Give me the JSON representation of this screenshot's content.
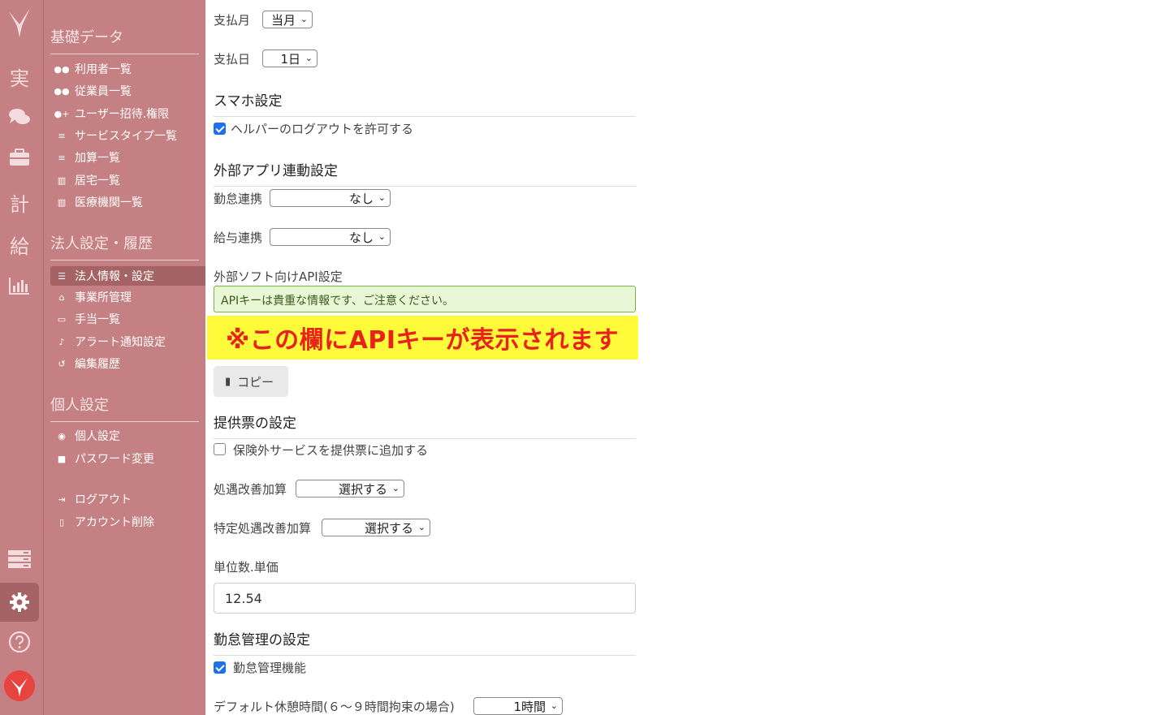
{
  "rail": {
    "items": [
      {
        "name": "logo",
        "glyph": "",
        "icon": "app-logo-icon"
      },
      {
        "name": "jisseki",
        "glyph": "実"
      },
      {
        "name": "chat",
        "glyph": "",
        "icon": "chat-bubbles-icon"
      },
      {
        "name": "briefcase",
        "glyph": "",
        "icon": "briefcase-icon"
      },
      {
        "name": "keikaku",
        "glyph": "計"
      },
      {
        "name": "kyuyo",
        "glyph": "給"
      },
      {
        "name": "chart",
        "glyph": "",
        "icon": "bar-chart-icon"
      },
      {
        "name": "server",
        "glyph": "",
        "icon": "server-icon"
      },
      {
        "name": "settings",
        "glyph": "",
        "icon": "gear-icon"
      },
      {
        "name": "help",
        "glyph": "",
        "icon": "help-circle-icon"
      },
      {
        "name": "brand",
        "glyph": "",
        "icon": "brand-logo-icon"
      }
    ]
  },
  "sidebar": {
    "section1_title": "基礎データ",
    "section1_items": [
      "利用者一覧",
      "従業員一覧",
      "ユーザー招待.権限",
      "サービスタイプ一覧",
      "加算一覧",
      "居宅一覧",
      "医療機関一覧"
    ],
    "section2_title": "法人設定・履歴",
    "section2_items": [
      "法人情報・設定",
      "事業所管理",
      "手当一覧",
      "アラート通知設定",
      "編集履歴"
    ],
    "section3_title": "個人設定",
    "section3_items": [
      "個人設定",
      "パスワード変更"
    ],
    "section4_items": [
      "ログアウト",
      "アカウント削除"
    ]
  },
  "form": {
    "pay_month_label": "支払月",
    "pay_month_value": "当月",
    "pay_day_label": "支払日",
    "pay_day_value": "1日",
    "smartphone_heading": "スマホ設定",
    "helper_logout_label": "ヘルパーのログアウトを許可する",
    "external_heading": "外部アプリ連動設定",
    "attendance_link_label": "勤怠連携",
    "attendance_link_value": "なし",
    "salary_link_label": "給与連携",
    "salary_link_value": "なし",
    "api_heading": "外部ソフト向けAPI設定",
    "api_notice": "APIキーは貴重な情報です、ご注意ください。",
    "api_key_overlay": "※この欄にAPIキーが表示されます",
    "copy_button": "コピー",
    "invoice_heading": "提供票の設定",
    "non_insured_label": "保険外サービスを提供票に追加する",
    "treatment_label": "処遇改善加算",
    "treatment_value": "選択する",
    "special_treatment_label": "特定処遇改善加算",
    "special_treatment_value": "選択する",
    "unit_price_label": "単位数.単価",
    "unit_price_value": "12.54",
    "attendance_heading": "勤怠管理の設定",
    "attendance_feature_label": "勤怠管理機能",
    "default_break_label": "デフォルト休憩時間(６〜９時間拘束の場合)",
    "default_break_value": "1時間"
  },
  "colors": {
    "sidebar_bg": "#c58083",
    "active_bg": "#a56366",
    "notice_bg": "#e8f7d6",
    "notice_border": "#7cb342",
    "highlight_bg": "#fffb3b",
    "highlight_text": "#e8221a",
    "checkbox_on": "#1f6feb"
  }
}
